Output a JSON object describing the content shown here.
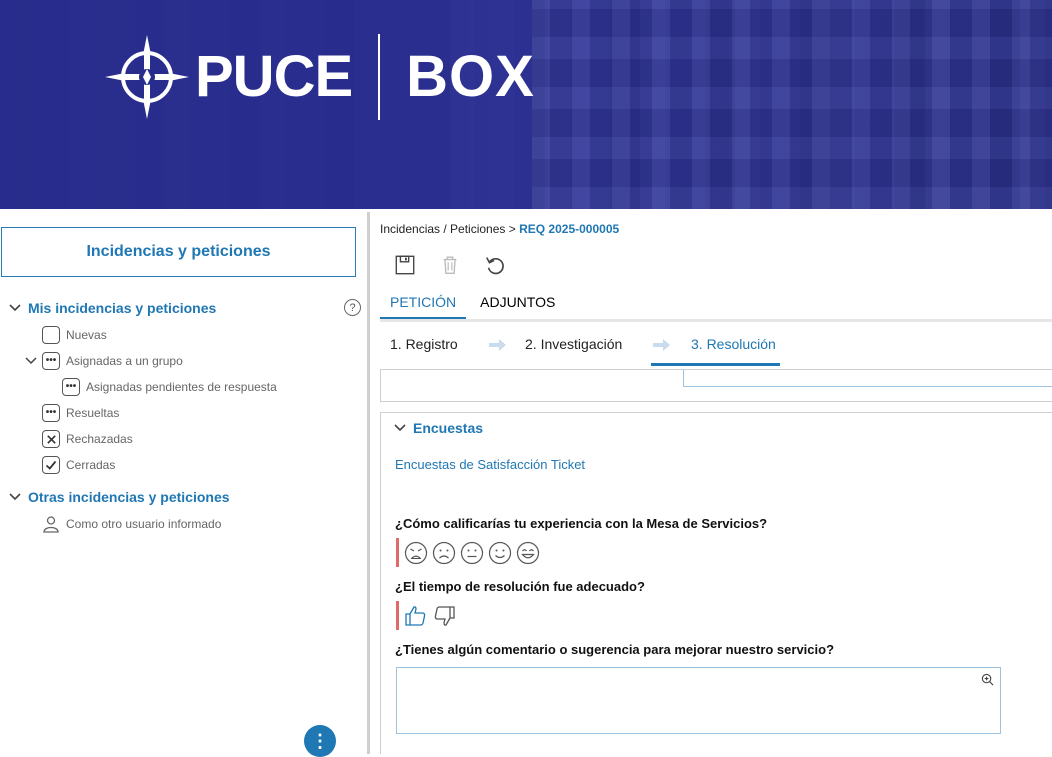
{
  "banner": {
    "brand": "PUCE",
    "product": "BOX"
  },
  "left": {
    "title": "Incidencias y peticiones",
    "help_icon": "?",
    "sections": [
      {
        "label": "Mis incidencias y peticiones"
      },
      {
        "label": "Otras incidencias y peticiones"
      }
    ],
    "items": {
      "nuevas": "Nuevas",
      "asignadas_grupo": "Asignadas a un grupo",
      "asignadas_pendientes": "Asignadas pendientes de respuesta",
      "resueltas": "Resueltas",
      "rechazadas": "Rechazadas",
      "cerradas": "Cerradas",
      "otro_usuario": "Como otro usuario informado"
    },
    "fab_icon": "⋮"
  },
  "breadcrumb": {
    "path": "Incidencias / Peticiones >",
    "req": "REQ 2025-000005"
  },
  "tabs": [
    {
      "label": "PETICIÓN",
      "active": true
    },
    {
      "label": "ADJUNTOS",
      "active": false
    }
  ],
  "steps": [
    {
      "label": "1. Registro"
    },
    {
      "label": "2. Investigación"
    },
    {
      "label": "3. Resolución",
      "active": true
    }
  ],
  "survey": {
    "section_title": "Encuestas",
    "link": "Encuestas de Satisfacción Ticket",
    "q1": "¿Cómo calificarías tu experiencia con la Mesa de Servicios?",
    "q2": "¿El tiempo de resolución fue adecuado?",
    "q3": "¿Tienes algún comentario o sugerencia para mejorar nuestro servicio?",
    "comment_value": ""
  },
  "colors": {
    "accent": "#1f77b4",
    "banner": "#282c8c",
    "required": "#e06a6a"
  }
}
